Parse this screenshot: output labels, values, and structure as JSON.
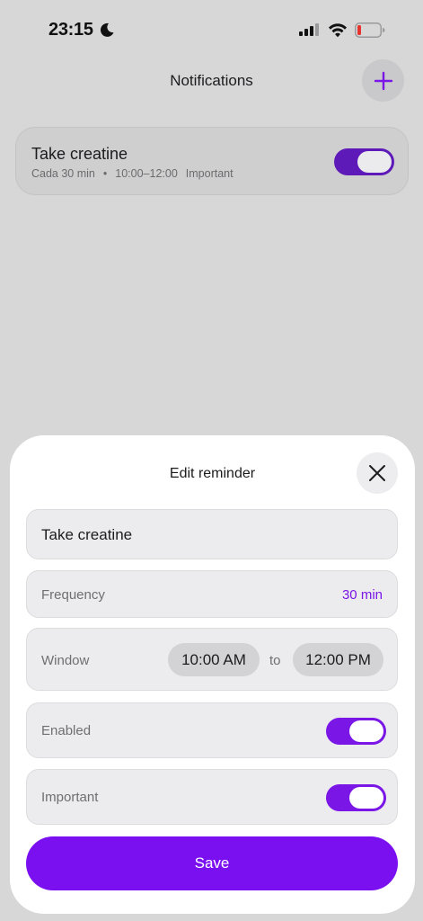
{
  "status_bar": {
    "time": "23:15",
    "focus_icon": "moon-icon",
    "signal_icon": "cellular-signal-icon",
    "wifi_icon": "wifi-icon",
    "battery_icon": "battery-low-icon"
  },
  "header": {
    "title": "Notifications",
    "add_icon": "plus-icon"
  },
  "reminders": [
    {
      "title": "Take creatine",
      "frequency": "Cada 30 min",
      "separator": "•",
      "window": "10:00–12:00",
      "priority": "Important",
      "enabled": true
    }
  ],
  "sheet": {
    "title": "Edit reminder",
    "close_icon": "close-icon",
    "name_value": "Take creatine",
    "frequency_label": "Frequency",
    "frequency_value": "30 min",
    "window_label": "Window",
    "window_start": "10:00 AM",
    "window_to": "to",
    "window_end": "12:00 PM",
    "enabled_label": "Enabled",
    "enabled": true,
    "important_label": "Important",
    "important": true,
    "save_label": "Save"
  },
  "colors": {
    "accent": "#7a0ff0",
    "toggle_on": "#7a16e6",
    "battery_low": "#e5332f"
  }
}
